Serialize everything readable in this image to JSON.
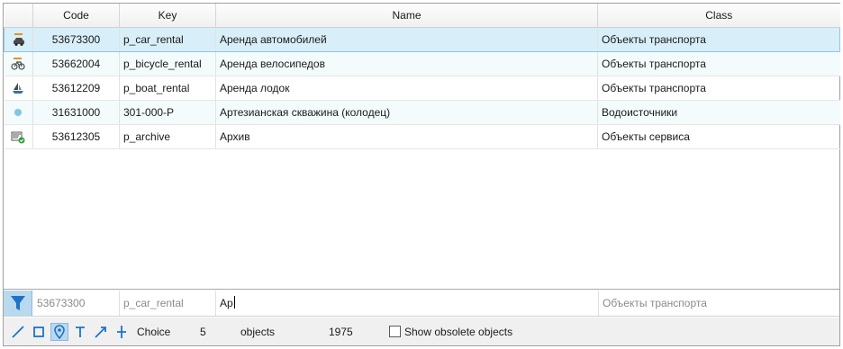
{
  "table": {
    "columns": {
      "icon": "",
      "code": "Code",
      "key": "Key",
      "name": "Name",
      "class": "Class"
    },
    "rows": [
      {
        "icon": "car-rental-icon",
        "code": "53673300",
        "key": "p_car_rental",
        "name": "Аренда автомобилей",
        "class": "Объекты транспорта",
        "selected": true
      },
      {
        "icon": "bicycle-rental-icon",
        "code": "53662004",
        "key": "p_bicycle_rental",
        "name": "Аренда велосипедов",
        "class": "Объекты транспорта",
        "selected": false
      },
      {
        "icon": "boat-rental-icon",
        "code": "53612209",
        "key": "p_boat_rental",
        "name": "Аренда лодок",
        "class": "Объекты транспорта",
        "selected": false
      },
      {
        "icon": "water-well-icon",
        "code": "31631000",
        "key": "301-000-P",
        "name": "Артезианская скважина (колодец)",
        "class": "Водоисточники",
        "selected": false
      },
      {
        "icon": "archive-icon",
        "code": "53612305",
        "key": "p_archive",
        "name": "Архив",
        "class": "Объекты сервиса",
        "selected": false
      }
    ]
  },
  "filter": {
    "code_hint": "53673300",
    "key_hint": "p_car_rental",
    "name_value": "Ар",
    "class_hint": "Объекты транспорта"
  },
  "status": {
    "tools": [
      "line-tool-icon",
      "rectangle-tool-icon",
      "point-tool-icon",
      "text-tool-icon",
      "arrow-tool-icon",
      "cross-tool-icon"
    ],
    "active_tool": "point-tool-icon",
    "choice_label": "Choice",
    "choice_count": "5",
    "objects_label": "objects",
    "total_count": "1975",
    "show_obsolete_label": "Show obsolete objects",
    "show_obsolete_checked": false
  },
  "colors": {
    "selection": "#d8eef8",
    "alt_row": "#f3fbfc",
    "accent": "#1e73c8"
  }
}
